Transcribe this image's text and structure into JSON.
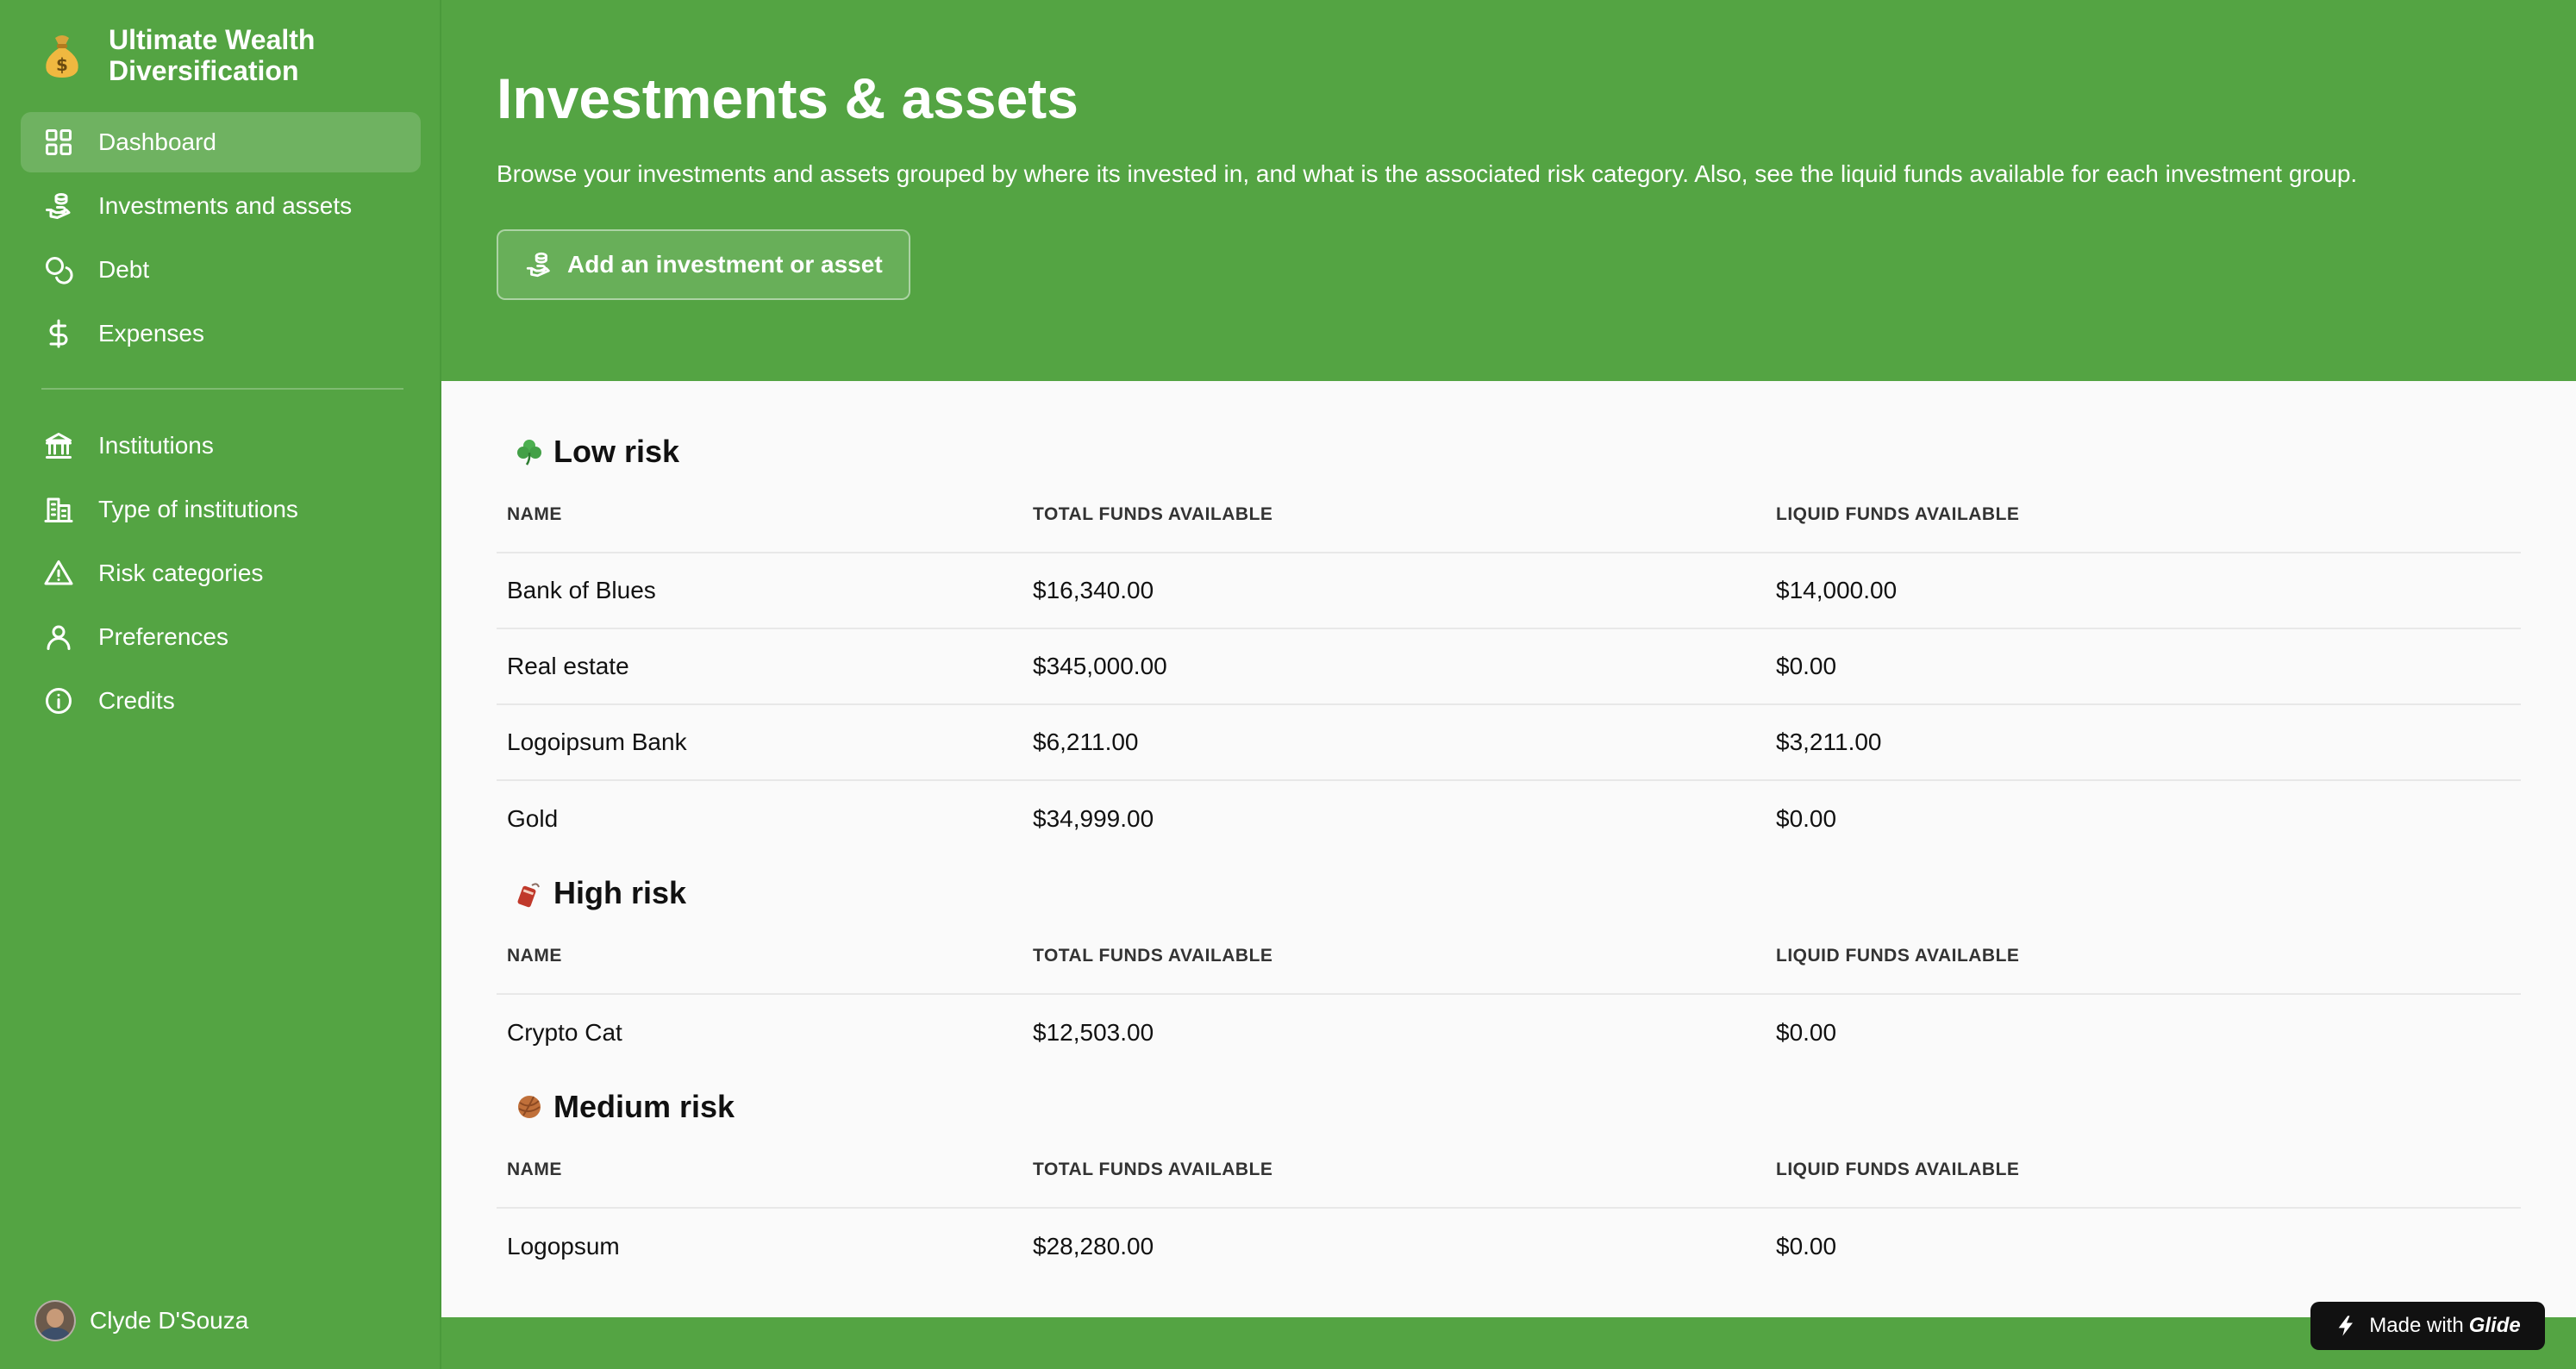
{
  "app": {
    "title": "Ultimate Wealth Diversification",
    "logo_icon": "money-bag-icon"
  },
  "sidebar": {
    "items": [
      {
        "label": "Dashboard",
        "icon": "grid-icon",
        "active": true
      },
      {
        "label": "Investments and assets",
        "icon": "hand-coins-icon"
      },
      {
        "label": "Debt",
        "icon": "coins-icon"
      },
      {
        "label": "Expenses",
        "icon": "dollar-icon"
      },
      {
        "label": "Institutions",
        "icon": "bank-icon"
      },
      {
        "label": "Type of institutions",
        "icon": "building-icon"
      },
      {
        "label": "Risk categories",
        "icon": "warning-icon"
      },
      {
        "label": "Preferences",
        "icon": "user-icon"
      },
      {
        "label": "Credits",
        "icon": "info-icon"
      }
    ],
    "user": {
      "name": "Clyde D'Souza"
    }
  },
  "header": {
    "title": "Investments & assets",
    "description": "Browse your investments and assets grouped by where its invested in, and what is the associated risk category. Also, see the liquid funds available for each investment group.",
    "add_button_label": "Add an investment or asset"
  },
  "table_headers": {
    "name": "NAME",
    "total": "TOTAL FUNDS AVAILABLE",
    "liquid": "LIQUID FUNDS AVAILABLE"
  },
  "groups": [
    {
      "title": "Low risk",
      "emoji_icon": "clover-icon",
      "rows": [
        {
          "name": "Bank of Blues",
          "total": "$16,340.00",
          "liquid": "$14,000.00"
        },
        {
          "name": "Real estate",
          "total": "$345,000.00",
          "liquid": "$0.00"
        },
        {
          "name": "Logoipsum Bank",
          "total": "$6,211.00",
          "liquid": "$3,211.00"
        },
        {
          "name": "Gold",
          "total": "$34,999.00",
          "liquid": "$0.00"
        }
      ]
    },
    {
      "title": "High risk",
      "emoji_icon": "firecracker-icon",
      "rows": [
        {
          "name": "Crypto Cat",
          "total": "$12,503.00",
          "liquid": "$0.00"
        }
      ]
    },
    {
      "title": "Medium risk",
      "emoji_icon": "yarn-ball-icon",
      "rows": [
        {
          "name": "Logopsum",
          "total": "$28,280.00",
          "liquid": "$0.00"
        }
      ]
    }
  ],
  "footer_badge": {
    "prefix": "Made with",
    "brand": "Glide"
  },
  "colors": {
    "primary": "#54a443",
    "content_bg": "#fafafa",
    "badge_bg": "#111111"
  }
}
